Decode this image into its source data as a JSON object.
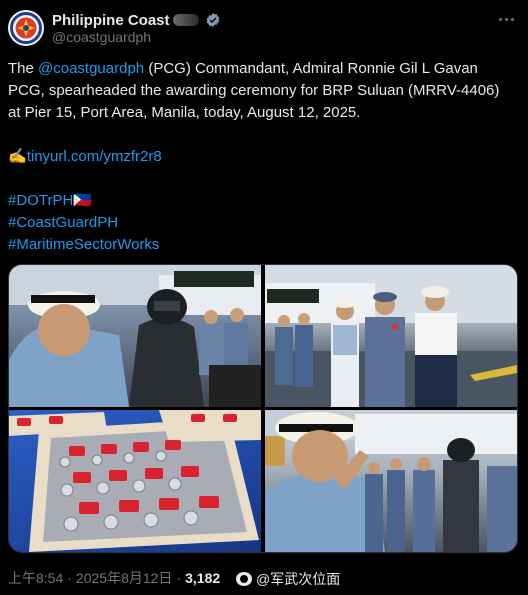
{
  "author": {
    "display_name": "Philippine Coast",
    "handle": "@coastguardph",
    "avatar_icon": "pcg-seal-icon",
    "verified_icon": "verified-badge-icon"
  },
  "post": {
    "line1_prefix": "The ",
    "mention": "@coastguardph",
    "line1_suffix": " (PCG) Commandant, Admiral Ronnie Gil L Gavan PCG, spearheaded the awarding ceremony for BRP Suluan (MRRV-4406) at Pier 15, Port Area, Manila, today, August 12, 2025.",
    "link_emoji": "✍️",
    "link_text": "tinyurl.com/ymzfr2r8",
    "hashtag1": "#DOTrPH",
    "hashtag1_flag": "🇵🇭",
    "hashtag2": "#CoastGuardPH",
    "hashtag3": "#MaritimeSectorWorks"
  },
  "media": {
    "photo1": "commandant-awarding-officer-photo",
    "photo2": "pinning-medal-photo",
    "photo3": "medals-tray-photo",
    "photo4": "commandant-saluting-photo"
  },
  "footer": {
    "time": "上午8:54",
    "separator": "·",
    "date": "2025年8月12日",
    "views": "3,182",
    "watermark": "@军武次位面"
  },
  "colors": {
    "background": "#000000",
    "text": "#e7e9ea",
    "secondary": "#71767b",
    "link": "#1d9bf0",
    "verified": "#829aab"
  }
}
